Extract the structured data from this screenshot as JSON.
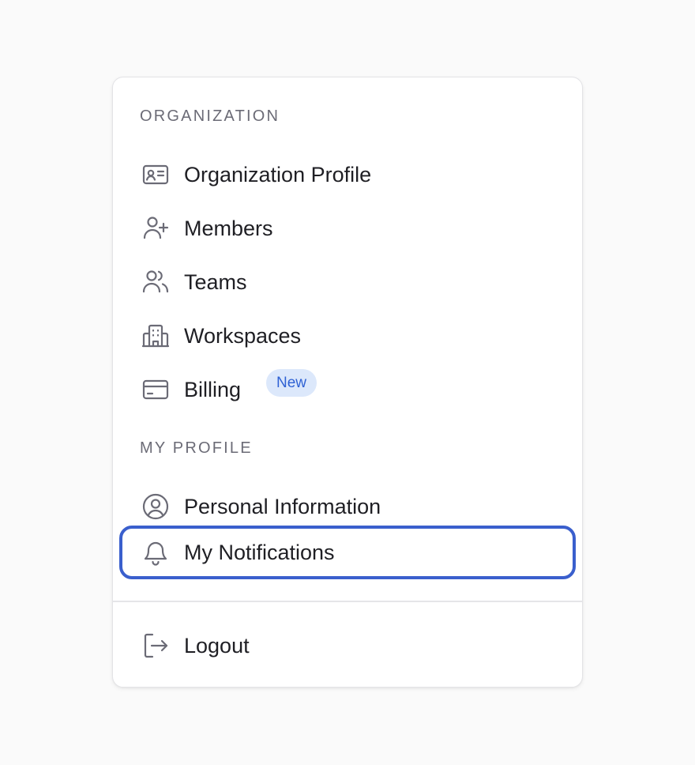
{
  "sections": {
    "organization": {
      "label": "ORGANIZATION",
      "items": [
        {
          "label": "Organization Profile",
          "icon": "id-card-icon"
        },
        {
          "label": "Members",
          "icon": "user-plus-icon"
        },
        {
          "label": "Teams",
          "icon": "users-icon"
        },
        {
          "label": "Workspaces",
          "icon": "building-icon"
        },
        {
          "label": "Billing",
          "icon": "credit-card-icon",
          "badge": "New"
        }
      ]
    },
    "my_profile": {
      "label": "MY PROFILE",
      "items": [
        {
          "label": "Personal Information",
          "icon": "user-circle-icon"
        },
        {
          "label": "My Notifications",
          "icon": "bell-icon",
          "focused": true
        }
      ]
    }
  },
  "footer": {
    "logout_label": "Logout",
    "icon": "logout-icon"
  },
  "colors": {
    "focus_ring": "#3a5fcd",
    "badge_bg": "#dce8fb",
    "badge_text": "#2f62d4",
    "icon": "#6b6b76",
    "text": "#1f1f24",
    "section_label": "#6b6b76"
  }
}
